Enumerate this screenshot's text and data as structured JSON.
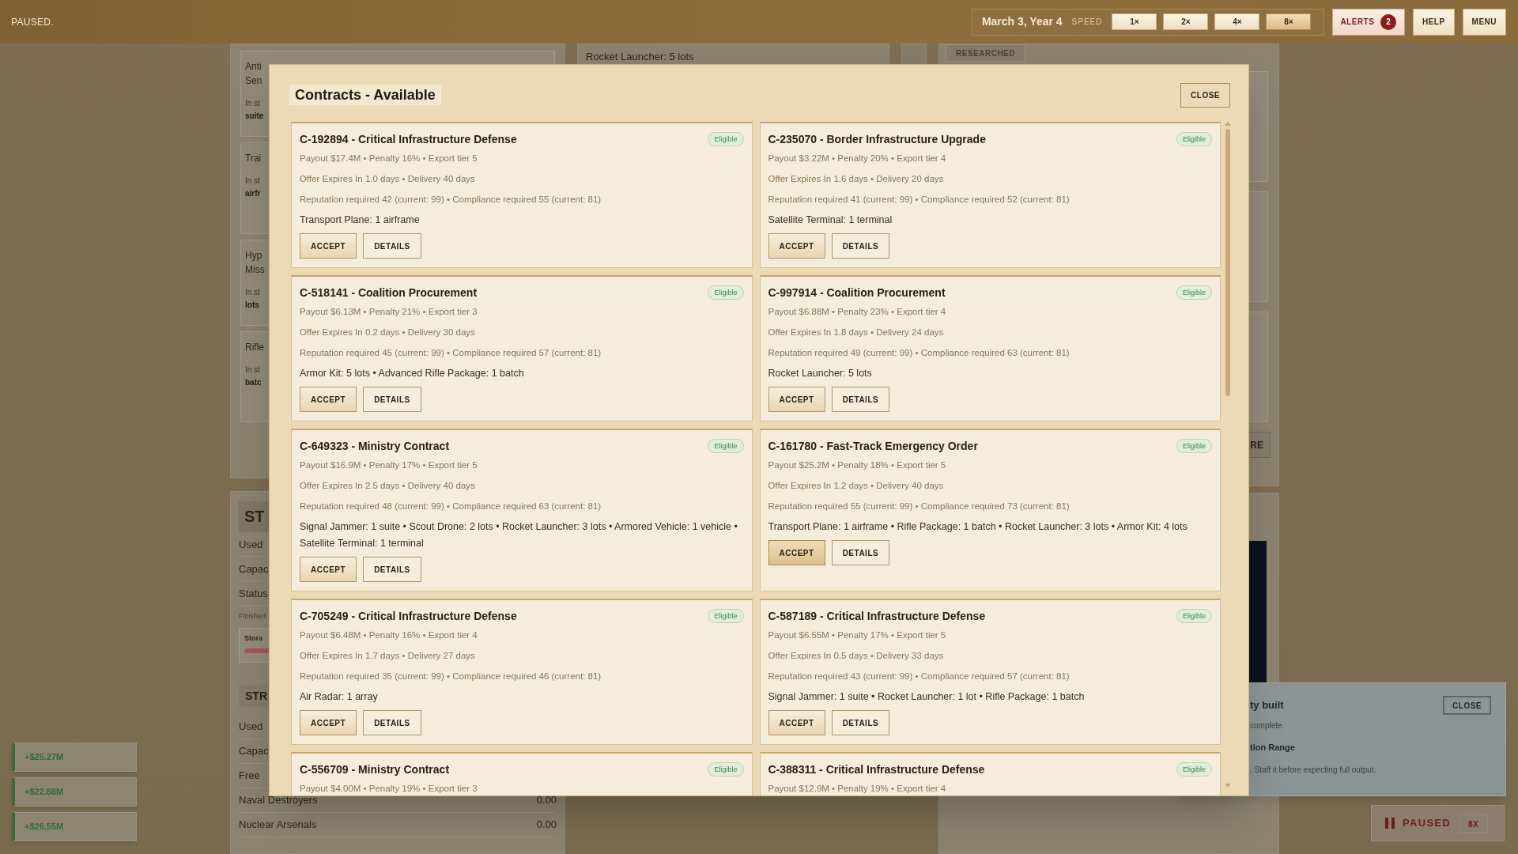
{
  "top_bar": {
    "status": "PAUSED.",
    "date": "March 3, Year 4",
    "speed_label": "SPEED",
    "speeds": [
      {
        "label": "1×",
        "selected": false
      },
      {
        "label": "2×",
        "selected": false
      },
      {
        "label": "4×",
        "selected": false
      },
      {
        "label": "8×",
        "selected": true
      }
    ],
    "alerts": {
      "label": "ALERTS",
      "count": "2"
    },
    "buttons": [
      "HELP",
      "MENU"
    ]
  },
  "background": {
    "left_items": [
      {
        "lines": [
          "Anti",
          "Sen"
        ],
        "stock": "In st",
        "qty": "suite"
      },
      {
        "lines": [
          "Trai"
        ],
        "stock": "In st",
        "qty": "airfr"
      },
      {
        "lines": [
          "Hyp",
          "Miss"
        ],
        "stock": "In st",
        "qty": "lots"
      },
      {
        "lines": [
          "Rifle"
        ],
        "stock": "In st",
        "qty": "batc"
      }
    ],
    "storage_panel": {
      "heading": "ST",
      "rows": [
        "Used",
        "Capac",
        "Status"
      ],
      "note": "Finished",
      "storage_label": "Stora"
    },
    "stock_panel": {
      "heading": "STR",
      "rows": [
        {
          "label": "Used"
        },
        {
          "label": "Capac"
        },
        {
          "label": "Free"
        },
        {
          "label": "Naval Destroyers",
          "value": "0.00"
        },
        {
          "label": "Nuclear Arsenals",
          "value": "0.00"
        }
      ]
    },
    "middle_text": "Rocket Launcher: 5 lots",
    "researched": "RESEARCHED",
    "right_button": "RE"
  },
  "modal": {
    "title": "Contracts - Available",
    "close": "CLOSE",
    "contracts": [
      {
        "title": "C-192894 - Critical Infrastructure Defense",
        "badge": "Eligible",
        "lines": [
          "Payout $17.4M • Penalty 16% • Export tier 5",
          "Offer Expires In 1.0 days • Delivery 40 days",
          "Reputation required 42 (current: 99) • Compliance required 55 (current: 81)"
        ],
        "items": "Transport Plane: 1 airframe",
        "actions": [
          {
            "label": "ACCEPT",
            "hovered": false
          },
          {
            "label": "DETAILS",
            "hovered": false
          }
        ]
      },
      {
        "title": "C-235070 - Border Infrastructure Upgrade",
        "badge": "Eligible",
        "lines": [
          "Payout $3.22M • Penalty 20% • Export tier 4",
          "Offer Expires In 1.6 days • Delivery 20 days",
          "Reputation required 41 (current: 99) • Compliance required 52 (current: 81)"
        ],
        "items": "Satellite Terminal: 1 terminal",
        "actions": [
          {
            "label": "ACCEPT",
            "hovered": false
          },
          {
            "label": "DETAILS",
            "hovered": false
          }
        ]
      },
      {
        "title": "C-518141 - Coalition Procurement",
        "badge": "Eligible",
        "lines": [
          "Payout $6.13M • Penalty 21% • Export tier 3",
          "Offer Expires In 0.2 days • Delivery 30 days",
          "Reputation required 45 (current: 99) • Compliance required 57 (current: 81)"
        ],
        "items": "Armor Kit: 5 lots • Advanced Rifle Package: 1 batch",
        "actions": [
          {
            "label": "ACCEPT",
            "hovered": false
          },
          {
            "label": "DETAILS",
            "hovered": false
          }
        ]
      },
      {
        "title": "C-997914 - Coalition Procurement",
        "badge": "Eligible",
        "lines": [
          "Payout $6.88M • Penalty 23% • Export tier 4",
          "Offer Expires In 1.8 days • Delivery 24 days",
          "Reputation required 49 (current: 99) • Compliance required 63 (current: 81)"
        ],
        "items": "Rocket Launcher: 5 lots",
        "actions": [
          {
            "label": "ACCEPT",
            "hovered": false
          },
          {
            "label": "DETAILS",
            "hovered": false
          }
        ]
      },
      {
        "title": "C-649323 - Ministry Contract",
        "badge": "Eligible",
        "lines": [
          "Payout $16.9M • Penalty 17% • Export tier 5",
          "Offer Expires In 2.5 days • Delivery 40 days",
          "Reputation required 48 (current: 99) • Compliance required 63 (current: 81)"
        ],
        "items": "Signal Jammer: 1 suite • Scout Drone: 2 lots • Rocket Launcher: 3 lots • Armored Vehicle: 1 vehicle • Satellite Terminal: 1 terminal",
        "actions": [
          {
            "label": "ACCEPT",
            "hovered": false
          },
          {
            "label": "DETAILS",
            "hovered": false
          }
        ]
      },
      {
        "title": "C-161780 - Fast-Track Emergency Order",
        "badge": "Eligible",
        "lines": [
          "Payout $25.2M • Penalty 18% • Export tier 5",
          "Offer Expires In 1.2 days • Delivery 40 days",
          "Reputation required 55 (current: 99) • Compliance required 73 (current: 81)"
        ],
        "items": "Transport Plane: 1 airframe • Rifle Package: 1 batch • Rocket Launcher: 3 lots • Armor Kit: 4 lots",
        "actions": [
          {
            "label": "ACCEPT",
            "hovered": true
          },
          {
            "label": "DETAILS",
            "hovered": false
          }
        ]
      },
      {
        "title": "C-705249 - Critical Infrastructure Defense",
        "badge": "Eligible",
        "lines": [
          "Payout $6.48M • Penalty 16% • Export tier 4",
          "Offer Expires In 1.7 days • Delivery 27 days",
          "Reputation required 35 (current: 99) • Compliance required 46 (current: 81)"
        ],
        "items": "Air Radar: 1 array",
        "actions": [
          {
            "label": "ACCEPT",
            "hovered": false
          },
          {
            "label": "DETAILS",
            "hovered": false
          }
        ]
      },
      {
        "title": "C-587189 - Critical Infrastructure Defense",
        "badge": "Eligible",
        "lines": [
          "Payout $6.55M • Penalty 17% • Export tier 5",
          "Offer Expires In 0.5 days • Delivery 33 days",
          "Reputation required 43 (current: 99) • Compliance required 57 (current: 81)"
        ],
        "items": "Signal Jammer: 1 suite • Rocket Launcher: 1 lot • Rifle Package: 1 batch",
        "actions": [
          {
            "label": "ACCEPT",
            "hovered": false
          },
          {
            "label": "DETAILS",
            "hovered": false
          }
        ]
      },
      {
        "title": "C-556709 - Ministry Contract",
        "badge": "Eligible",
        "lines": [
          "Payout $4.00M • Penalty 19% • Export tier 3"
        ]
      },
      {
        "title": "C-388311 - Critical Infrastructure Defense",
        "badge": "Eligible",
        "lines": [
          "Payout $12.9M • Penalty 19% • Export tier 4"
        ]
      }
    ]
  },
  "notification": {
    "title": "ty built",
    "body": "complete.",
    "subtitle": "tion Range",
    "note": ". Staff it before expecting full output.",
    "close": "CLOSE"
  },
  "pause_widget": {
    "label": "PAUSED",
    "speed": "8X"
  },
  "toasts": [
    "+$25.27M",
    "+$22.88M",
    "+$26.55M"
  ]
}
